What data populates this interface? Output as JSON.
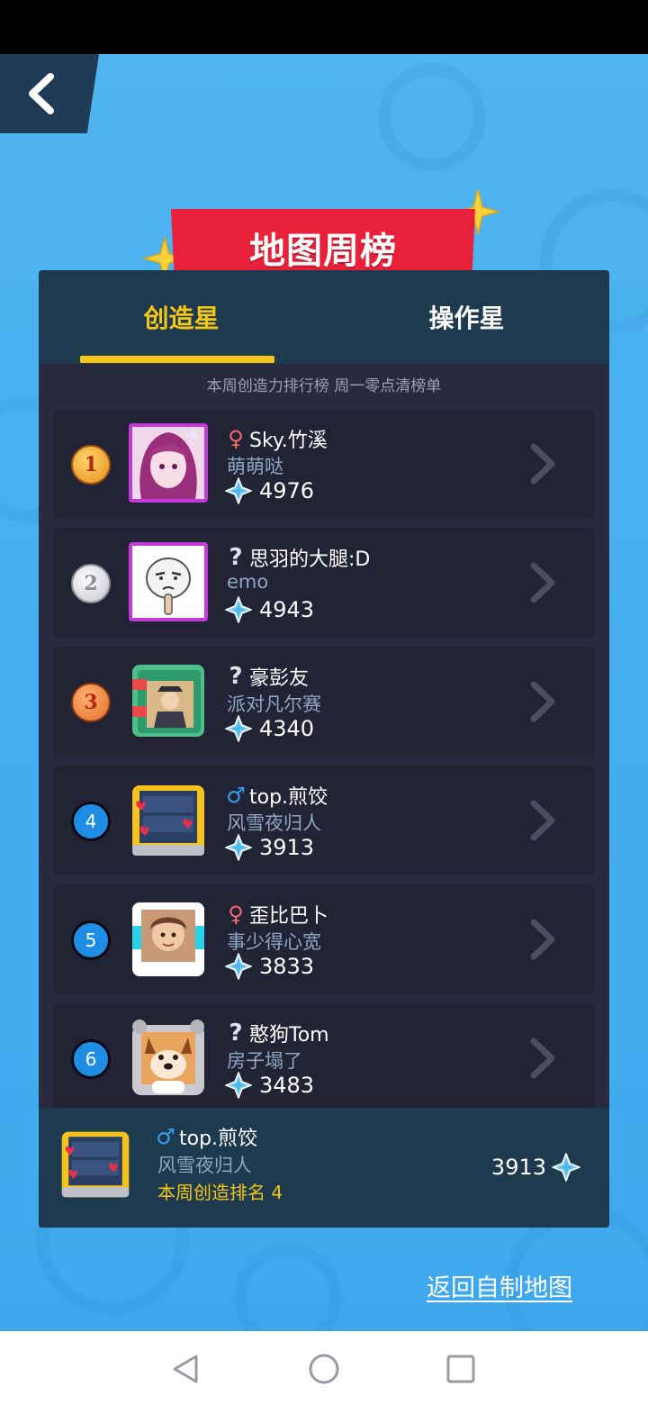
{
  "header": {
    "title": "地图周榜"
  },
  "tabs": [
    {
      "label": "创造星",
      "active": true
    },
    {
      "label": "操作星",
      "active": false
    }
  ],
  "notice": "本周创造力排行榜 周一零点清榜单",
  "icons": {
    "back": "chevron-left-icon",
    "score": "crystal-icon",
    "row_action": "chevron-right-icon"
  },
  "colors": {
    "accent": "#f5c518",
    "banner": "#e8203a",
    "panel": "#2a2a3e",
    "header_bar": "#1e3a4f"
  },
  "rankings": [
    {
      "rank": "1",
      "name": "Sky.竹溪",
      "gender": "female",
      "subtitle": "萌萌哒",
      "score": "4976"
    },
    {
      "rank": "2",
      "name": "思羽的大腿:D",
      "gender": "unknown",
      "subtitle": "emo",
      "score": "4943"
    },
    {
      "rank": "3",
      "name": "豪彭友",
      "gender": "unknown",
      "subtitle": "派对凡尔赛",
      "score": "4340"
    },
    {
      "rank": "4",
      "name": "top.煎饺",
      "gender": "male",
      "subtitle": "风雪夜归人",
      "score": "3913"
    },
    {
      "rank": "5",
      "name": "歪比巴卜",
      "gender": "female",
      "subtitle": "事少得心宽",
      "score": "3833"
    },
    {
      "rank": "6",
      "name": "憨狗Tom",
      "gender": "unknown",
      "subtitle": "房子塌了",
      "score": "3483"
    }
  ],
  "me": {
    "name": "top.煎饺",
    "gender": "male",
    "subtitle": "风雪夜归人",
    "rank_text": "本周创造排名 4",
    "score": "3913"
  },
  "footer": {
    "return_link": "返回自制地图"
  },
  "system_nav": [
    "back-triangle-icon",
    "home-circle-icon",
    "recents-square-icon"
  ]
}
